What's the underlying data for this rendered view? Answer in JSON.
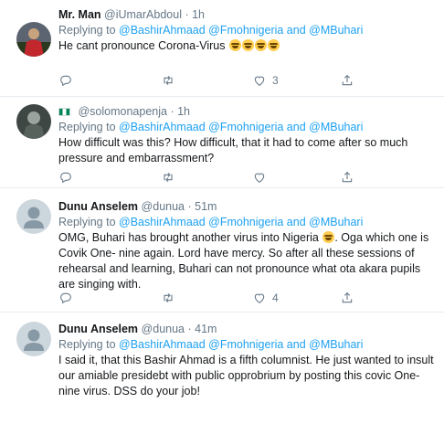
{
  "tweets": [
    {
      "name": "Mr. Man",
      "handle": "@iUmarAbdoul",
      "time": "· 1h",
      "replying_prefix": "Replying to ",
      "replying_users": "@BashirAhmaad @Fmohnigeria and @MBuhari",
      "text": "He cant pronounce Corona-Virus",
      "emoji_count": 4,
      "reply_count": "",
      "retweet_count": "",
      "like_count": "3"
    },
    {
      "name": "",
      "handle": "@solomonapenja",
      "time": "· 1h",
      "replying_prefix": "Replying to ",
      "replying_users": "@BashirAhmaad @Fmohnigeria and @MBuhari",
      "text": "How difficult was this? How difficult, that it had to come after so much pressure and embarrassment?",
      "reply_count": "",
      "retweet_count": "",
      "like_count": ""
    },
    {
      "name": "Dunu Anselem",
      "handle": "@dunua",
      "time": "· 51m",
      "replying_prefix": "Replying to ",
      "replying_users": "@BashirAhmaad @Fmohnigeria and @MBuhari",
      "text_a": "OMG, Buhari has brought another virus into Nigeria",
      "text_b": ". Oga which one is Covik One- nine again. Lord have mercy. So after all these sessions of rehearsal and learning, Buhari can not pronounce what  ota akara pupils are singing with.",
      "reply_count": "",
      "retweet_count": "",
      "like_count": "4"
    },
    {
      "name": "Dunu Anselem",
      "handle": "@dunua",
      "time": "· 41m",
      "replying_prefix": "Replying to ",
      "replying_users": "@BashirAhmaad @Fmohnigeria and @MBuhari",
      "text": "I said it, that this Bashir Ahmad is a fifth columnist. He just wanted to insult our amiable presidebt with public opprobrium by posting this covic One-nine virus. DSS do your job!"
    }
  ],
  "colors": {
    "text": "#14171a",
    "muted": "#657786",
    "link": "#1da1f2",
    "divider": "#e6ecf0"
  },
  "icons": [
    "reply-icon",
    "retweet-icon",
    "like-icon",
    "share-icon",
    "default-avatar-icon",
    "nigeria-flag-icon",
    "laughing-emoji-icon",
    "astonished-emoji-icon"
  ]
}
